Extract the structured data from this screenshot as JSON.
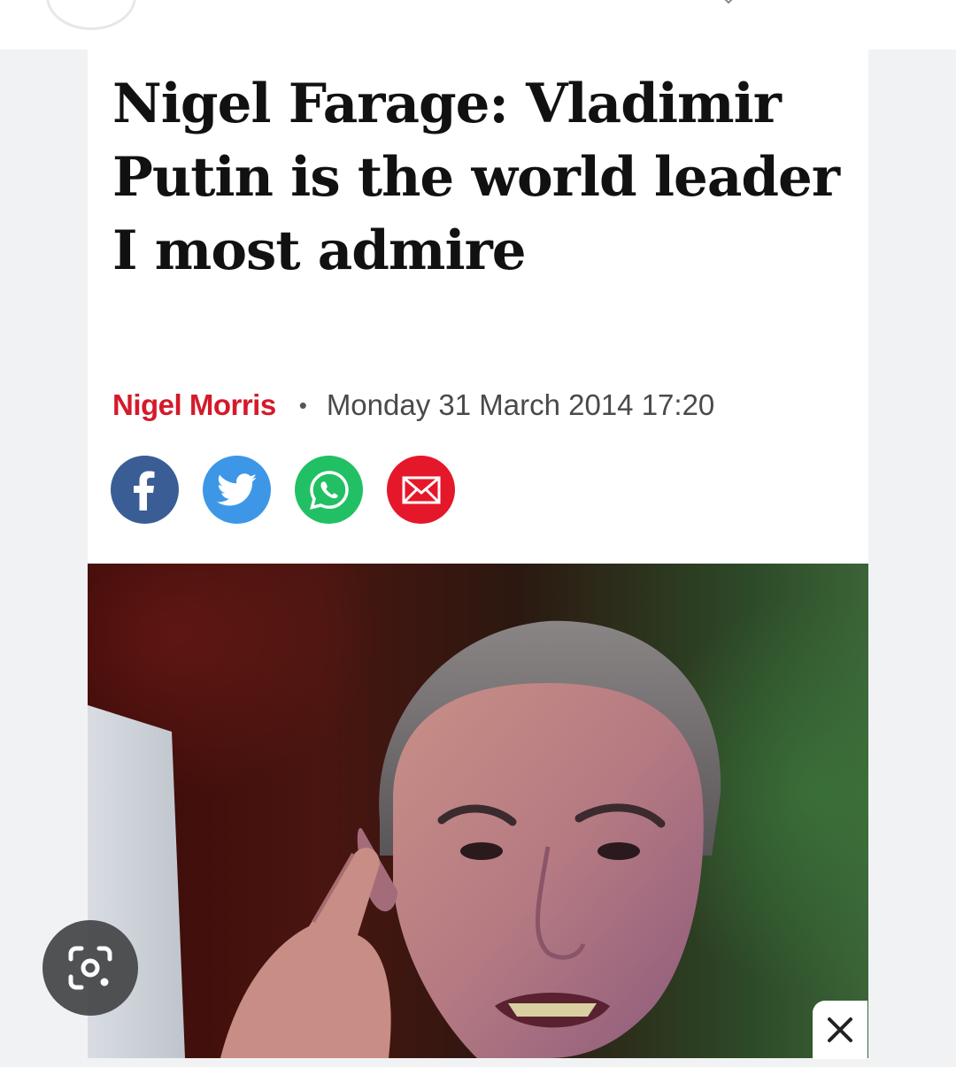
{
  "article": {
    "headline": "Nigel Farage: Vladimir Putin is the world leader I most admire",
    "author": "Nigel Morris",
    "separator": "•",
    "date": "Monday 31 March 2014 17:20"
  },
  "share": {
    "icons": [
      "facebook-icon",
      "twitter-icon",
      "whatsapp-icon",
      "email-icon"
    ]
  },
  "overlay": {
    "lens_icon": "lens-search-icon",
    "close_icon": "close-icon"
  },
  "colors": {
    "author": "#d41a2b",
    "facebook": "#3a5d96",
    "twitter": "#3d97e6",
    "whatsapp": "#22c064",
    "email": "#e5172a"
  }
}
